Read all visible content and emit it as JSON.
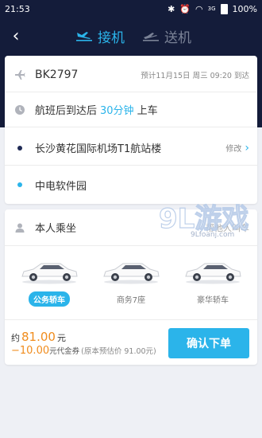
{
  "status_bar": {
    "time": "21:53",
    "signal": "3G",
    "battery": "100%"
  },
  "nav": {
    "tabs": [
      {
        "label": "接机",
        "icon": "plane-landing-icon",
        "active": true
      },
      {
        "label": "送机",
        "icon": "plane-takeoff-icon",
        "active": false
      }
    ]
  },
  "trip": {
    "flight_number": "BK2797",
    "flight_note": "预计11月15日 周三 09:20 到达",
    "pickup_prefix": "航班后到达后",
    "pickup_wait": "30分钟",
    "pickup_suffix": "上车",
    "origin": "长沙黄花国际机场T1航站楼",
    "origin_action": "修改",
    "destination": "中电软件园"
  },
  "rider": {
    "label": "本人乘坐",
    "link": "帮他人叫车"
  },
  "car_types": [
    {
      "name": "公务轿车",
      "selected": true
    },
    {
      "name": "商务7座",
      "selected": false
    },
    {
      "name": "豪华轿车",
      "selected": false
    }
  ],
  "pricing": {
    "prefix": "约",
    "amount": "81.00",
    "unit": "元",
    "discount": "−10.00",
    "discount_label": "元代金券",
    "original": "(原本预估价 91.00元)",
    "confirm_label": "确认下单"
  },
  "watermark": {
    "text": "9L游戏",
    "url": "9Lfoanj.com"
  },
  "colors": {
    "header": "#141c3a",
    "accent": "#2bb4ea",
    "price": "#f08c1d"
  }
}
